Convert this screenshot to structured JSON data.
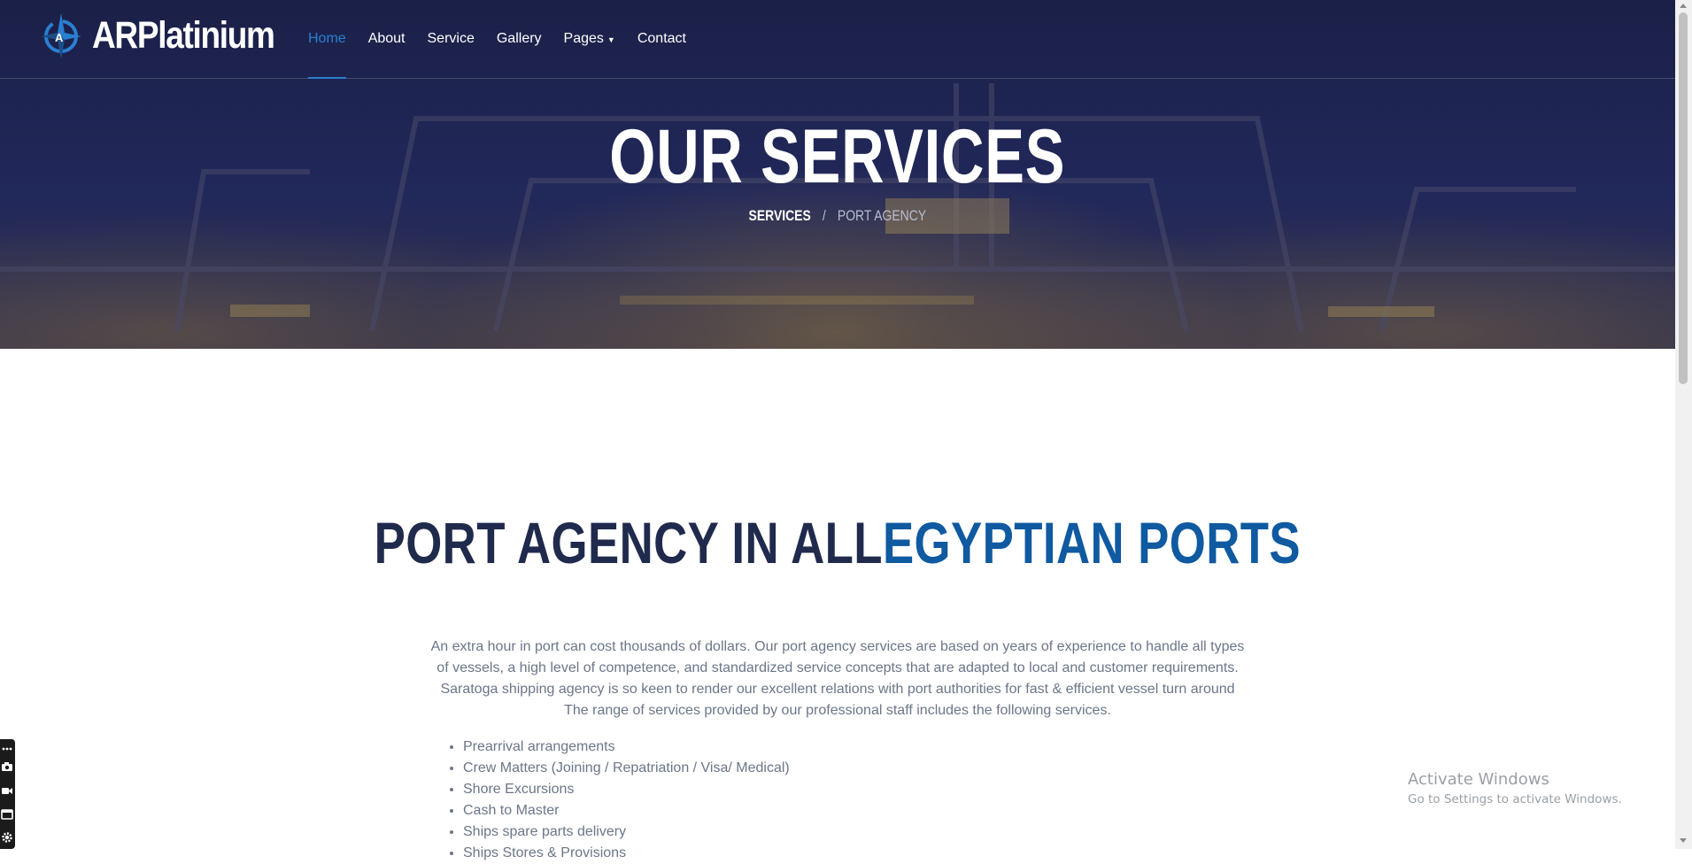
{
  "brand": {
    "name": "ARPlatinium",
    "logo_icon": "compass-logo-icon"
  },
  "nav": {
    "items": [
      {
        "label": "Home",
        "active": true
      },
      {
        "label": "About",
        "active": false
      },
      {
        "label": "Service",
        "active": false
      },
      {
        "label": "Gallery",
        "active": false
      },
      {
        "label": "Pages",
        "active": false,
        "has_dropdown": true
      },
      {
        "label": "Contact",
        "active": false
      }
    ]
  },
  "hero": {
    "title": "OUR SERVICES",
    "breadcrumb": {
      "link": "SERVICES",
      "separator": "/",
      "current": "PORT AGENCY"
    }
  },
  "section": {
    "title_part1": "PORT AGENCY IN ALL",
    "title_part2": "EGYPTIAN PORTS",
    "intro": "An extra hour in port can cost thousands of dollars. Our port agency services are based on years of experience to handle all types of vessels, a high level of competence, and standardized service concepts that are adapted to local and customer requirements. Saratoga shipping agency is so keen to render our excellent relations with port authorities for fast & efficient vessel turn around The range of services provided by our professional staff includes the following services.",
    "services": [
      "Prearrival arrangements",
      "Crew Matters (Joining / Repatriation / Visa/ Medical)",
      "Shore Excursions",
      "Cash to Master",
      "Ships spare parts delivery",
      "Ships Stores & Provisions"
    ]
  },
  "watermark": {
    "title": "Activate Windows",
    "subtitle": "Go to Settings to activate Windows."
  },
  "toolbar": {
    "icons": [
      "more-icon",
      "camera-icon",
      "video-icon",
      "window-icon",
      "gear-icon"
    ]
  },
  "colors": {
    "accent": "#2a7fd1",
    "title_dark": "#1f2a4d",
    "title_blue": "#0f5aa0",
    "hero_bg": "#1f2555",
    "body_text": "#6b7689"
  }
}
